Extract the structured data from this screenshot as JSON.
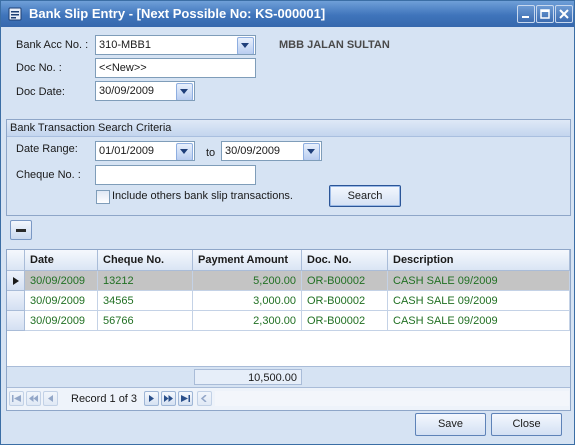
{
  "window": {
    "title": "Bank Slip Entry - [Next Possible No: KS-000001]"
  },
  "header": {
    "bank_acc_label": "Bank Acc No. :",
    "bank_acc_value": "310-MBB1",
    "bank_name": "MBB JALAN SULTAN",
    "doc_no_label": "Doc No. :",
    "doc_no_value": "<<New>>",
    "doc_date_label": "Doc Date:",
    "doc_date_value": "30/09/2009"
  },
  "criteria": {
    "title": "Bank Transaction Search Criteria",
    "date_range_label": "Date Range:",
    "date_from": "01/01/2009",
    "to_label": "to",
    "date_to": "30/09/2009",
    "cheque_label": "Cheque No. :",
    "cheque_value": "",
    "include_label": "Include others bank slip transactions.",
    "search_label": "Search"
  },
  "grid": {
    "columns": [
      "Date",
      "Cheque No.",
      "Payment Amount",
      "Doc. No.",
      "Description"
    ],
    "rows": [
      [
        "30/09/2009",
        "13212",
        "5,200.00",
        "OR-B00002",
        "CASH SALE 09/2009"
      ],
      [
        "30/09/2009",
        "34565",
        "3,000.00",
        "OR-B00002",
        "CASH SALE 09/2009"
      ],
      [
        "30/09/2009",
        "56766",
        "2,300.00",
        "OR-B00002",
        "CASH SALE 09/2009"
      ]
    ],
    "total": "10,500.00",
    "record_text": "Record 1 of 3"
  },
  "footer": {
    "save_label": "Save",
    "close_label": "Close"
  },
  "colors": {
    "title_bar": "#3f74bb",
    "grid_text": "#217023",
    "selected_row": "#c4c4c4"
  }
}
